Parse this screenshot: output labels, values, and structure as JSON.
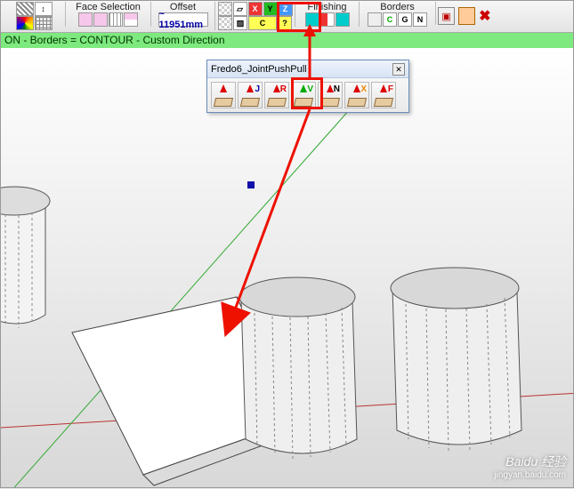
{
  "toolbar": {
    "groups": {
      "face_selection": {
        "label": "Face Selection"
      },
      "offset": {
        "label": "Offset",
        "value": "~ 11951mm"
      },
      "axis": {
        "x": "X",
        "y": "Y",
        "z": "Z",
        "c": "C",
        "q": "?"
      },
      "finishing": {
        "label": "Finishing"
      },
      "borders": {
        "label": "Borders",
        "c": "C",
        "g": "G",
        "n": "N"
      }
    }
  },
  "status": {
    "text": "ON - Borders = CONTOUR - Custom Direction"
  },
  "palette": {
    "title": "Fredo6_JointPushPull",
    "buttons": [
      {
        "tag": "",
        "tag_color": "#d00"
      },
      {
        "tag": "J",
        "tag_color": "#00a"
      },
      {
        "tag": "R",
        "tag_color": "#d00"
      },
      {
        "tag": "V",
        "tag_color": "#0a0"
      },
      {
        "tag": "N",
        "tag_color": "#000"
      },
      {
        "tag": "X",
        "tag_color": "#e80"
      },
      {
        "tag": "F",
        "tag_color": "#d00"
      }
    ]
  },
  "watermark": {
    "brand": "Baidu 经验",
    "url": "jingyan.baidu.com"
  }
}
